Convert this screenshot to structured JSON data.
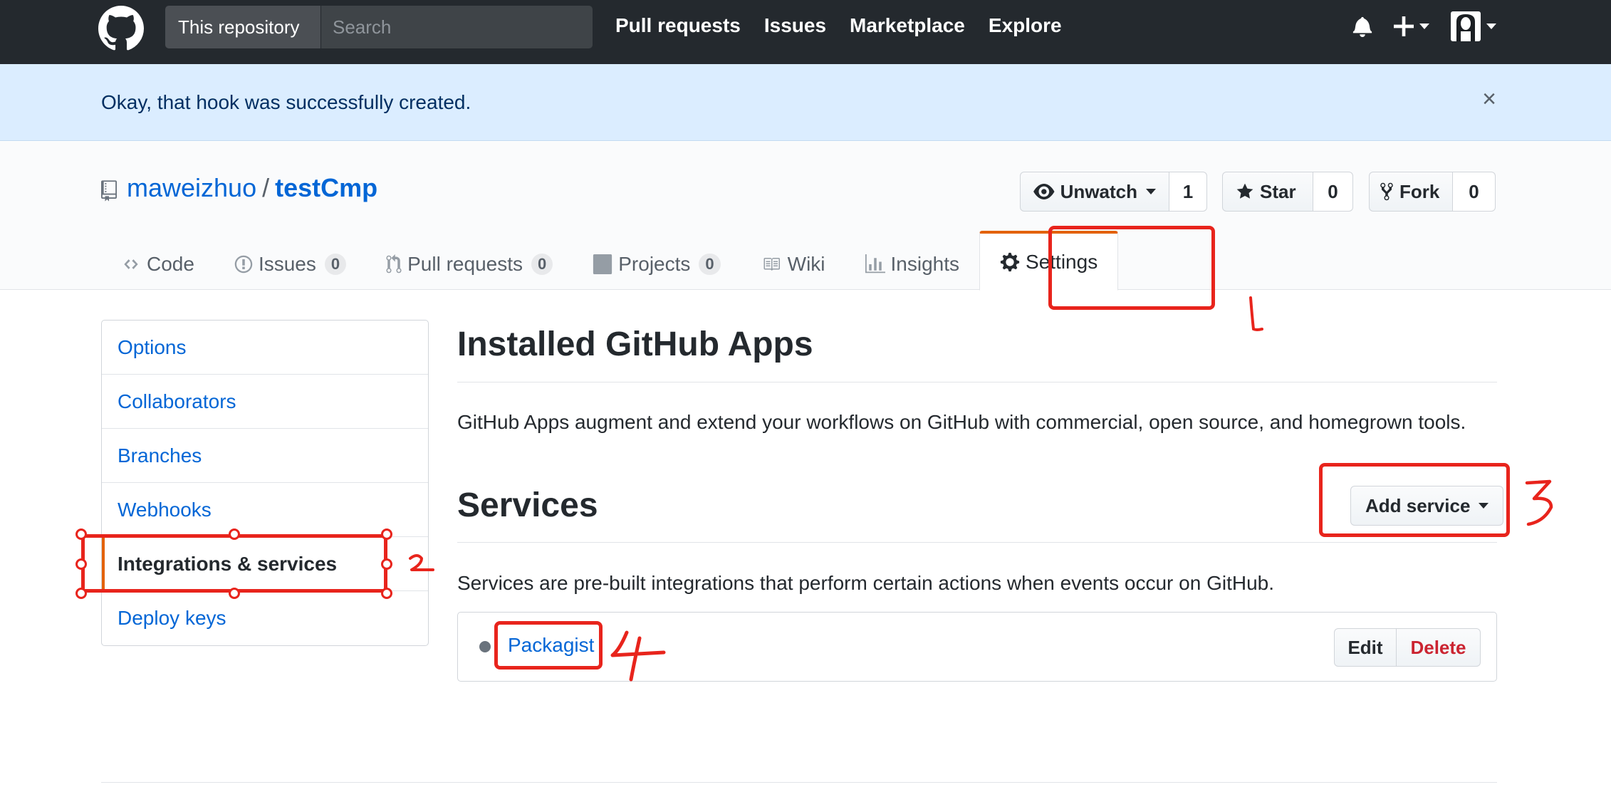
{
  "header": {
    "scope_label": "This repository",
    "search_placeholder": "Search",
    "nav": [
      "Pull requests",
      "Issues",
      "Marketplace",
      "Explore"
    ]
  },
  "flash": {
    "message": "Okay, that hook was successfully created.",
    "close": "×"
  },
  "repo": {
    "owner": "maweizhuo",
    "separator": "/",
    "name": "testCmp",
    "actions": {
      "unwatch_label": "Unwatch",
      "unwatch_count": "1",
      "star_label": "Star",
      "star_count": "0",
      "fork_label": "Fork",
      "fork_count": "0"
    }
  },
  "tabs": [
    {
      "label": "Code",
      "icon": "code-icon"
    },
    {
      "label": "Issues",
      "count": "0",
      "icon": "issue-icon"
    },
    {
      "label": "Pull requests",
      "count": "0",
      "icon": "pull-request-icon"
    },
    {
      "label": "Projects",
      "count": "0",
      "icon": "project-icon"
    },
    {
      "label": "Wiki",
      "icon": "book-icon"
    },
    {
      "label": "Insights",
      "icon": "graph-icon"
    },
    {
      "label": "Settings",
      "icon": "gear-icon",
      "selected": true
    }
  ],
  "sidebar": {
    "items": [
      {
        "label": "Options"
      },
      {
        "label": "Collaborators"
      },
      {
        "label": "Branches"
      },
      {
        "label": "Webhooks"
      },
      {
        "label": "Integrations & services",
        "selected": true
      },
      {
        "label": "Deploy keys"
      }
    ]
  },
  "main": {
    "apps_title": "Installed GitHub Apps",
    "apps_desc": "GitHub Apps augment and extend your workflows on GitHub with commercial, open source, and homegrown tools.",
    "services_title": "Services",
    "add_service_label": "Add service",
    "services_desc": "Services are pre-built integrations that perform certain actions when events occur on GitHub.",
    "service": {
      "name": "Packagist",
      "edit_label": "Edit",
      "delete_label": "Delete"
    }
  },
  "colors": {
    "header_bg": "#24292e",
    "flash_bg": "#dbedff",
    "link": "#0366d6",
    "selected_accent": "#e36209",
    "danger": "#cb2431",
    "annotation_red": "#e8241c"
  }
}
